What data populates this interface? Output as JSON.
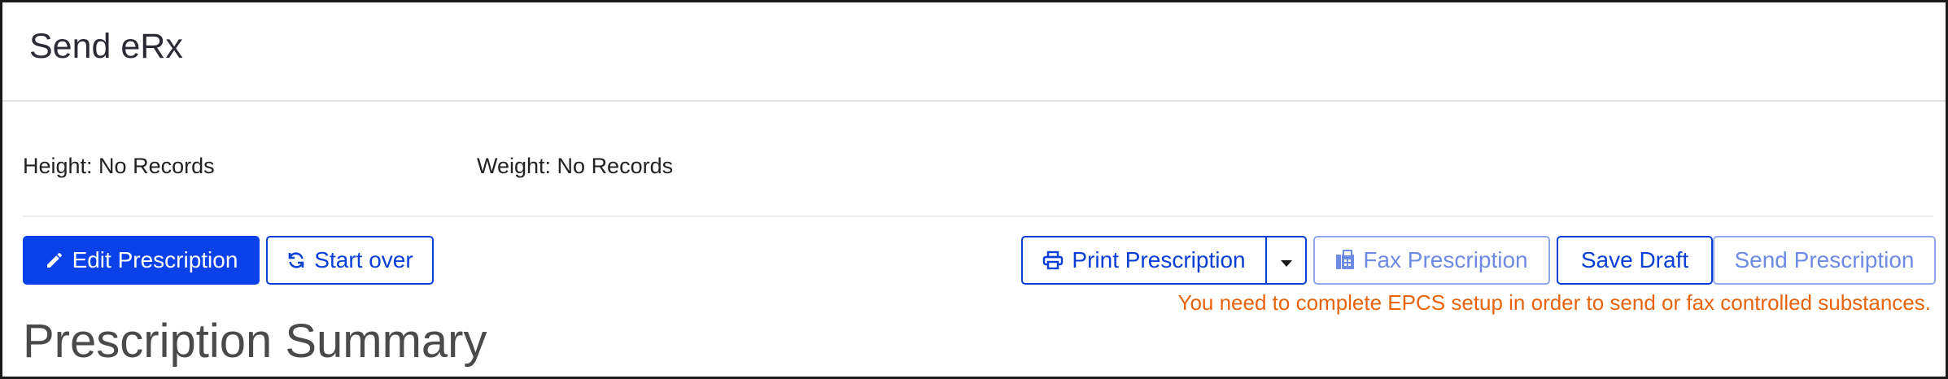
{
  "header": {
    "title": "Send eRx"
  },
  "vitals": {
    "height": "Height: No Records",
    "weight": "Weight: No Records"
  },
  "actions": {
    "edit_label": "Edit Prescription",
    "start_over_label": "Start over",
    "print_label": "Print Prescription",
    "fax_label": "Fax Prescription",
    "save_draft_label": "Save Draft",
    "send_label": "Send Prescription"
  },
  "warning": "You need to complete EPCS setup in order to send or fax controlled substances.",
  "summary": {
    "title": "Prescription Summary"
  },
  "colors": {
    "primary": "#0b41e8",
    "warning": "#e8640c",
    "disabled": "#6d8be3"
  },
  "icons": {
    "edit": "pencil-icon",
    "start_over": "refresh-icon",
    "print": "printer-icon",
    "print_menu": "caret-down-icon",
    "fax": "fax-icon"
  }
}
